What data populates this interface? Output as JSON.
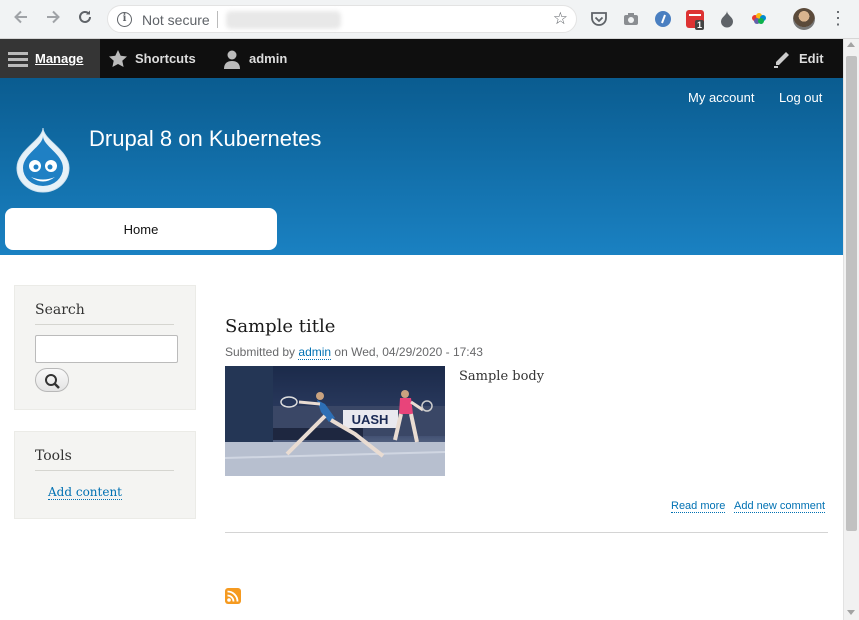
{
  "browser": {
    "security_label": "Not secure",
    "extension_badge": "1"
  },
  "toolbar": {
    "manage": "Manage",
    "shortcuts": "Shortcuts",
    "user": "admin",
    "edit": "Edit"
  },
  "header": {
    "secondary_links": [
      "My account",
      "Log out"
    ],
    "site_name": "Drupal 8 on Kubernetes",
    "nav": [
      "Home"
    ]
  },
  "sidebar": {
    "search": {
      "title": "Search",
      "placeholder": ""
    },
    "tools": {
      "title": "Tools",
      "links": [
        "Add content"
      ]
    }
  },
  "article": {
    "title": "Sample title",
    "submitted_prefix": "Submitted by",
    "author": "admin",
    "submitted_suffix": "on Wed, 04/29/2020 - 17:43",
    "body": "Sample body",
    "links": [
      "Read more",
      "Add new comment"
    ]
  },
  "colors": {
    "header_top": "#0a5c90",
    "header_bottom": "#1a81c2",
    "link": "#0071b3",
    "toolbar": "#0f0f0f",
    "rss": "#f59a20"
  }
}
